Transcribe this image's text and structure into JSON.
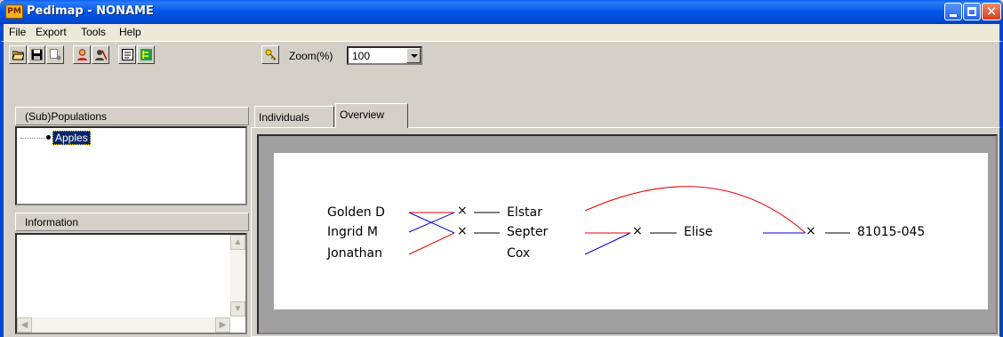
{
  "window": {
    "title": "Pedimap - NONAME",
    "icon_text": "PM"
  },
  "menu": [
    {
      "label": "File"
    },
    {
      "label": "Export"
    },
    {
      "label": "Tools"
    },
    {
      "label": "Help"
    }
  ],
  "toolbar": {
    "buttons": [
      {
        "icon": "open-folder-icon"
      },
      {
        "icon": "save-disk-icon"
      },
      {
        "icon": "add-data-icon"
      },
      {
        "icon": "person-icon"
      },
      {
        "icon": "person-tool-icon"
      },
      {
        "icon": "properties-icon"
      },
      {
        "icon": "tree-view-icon"
      },
      {
        "icon": "key-icon"
      }
    ],
    "zoom_label": "Zoom(%)",
    "zoom_value": "100"
  },
  "left_panel": {
    "populations_header": "(Sub)Populations",
    "populations": [
      "Apples"
    ],
    "information_header": "Information"
  },
  "tabs": [
    {
      "label": "Individuals",
      "active": false
    },
    {
      "label": "Overview",
      "active": true
    }
  ],
  "pedigree": {
    "parents": [
      "Golden D",
      "Ingrid M",
      "Jonathan"
    ],
    "gen1": [
      "Elstar",
      "Septer",
      "Cox"
    ],
    "gen2": [
      "Elise"
    ],
    "gen3": [
      "81015-045"
    ],
    "cross_symbol": "×",
    "colors": {
      "maternal": "#e80000",
      "paternal": "#0000e0"
    }
  }
}
